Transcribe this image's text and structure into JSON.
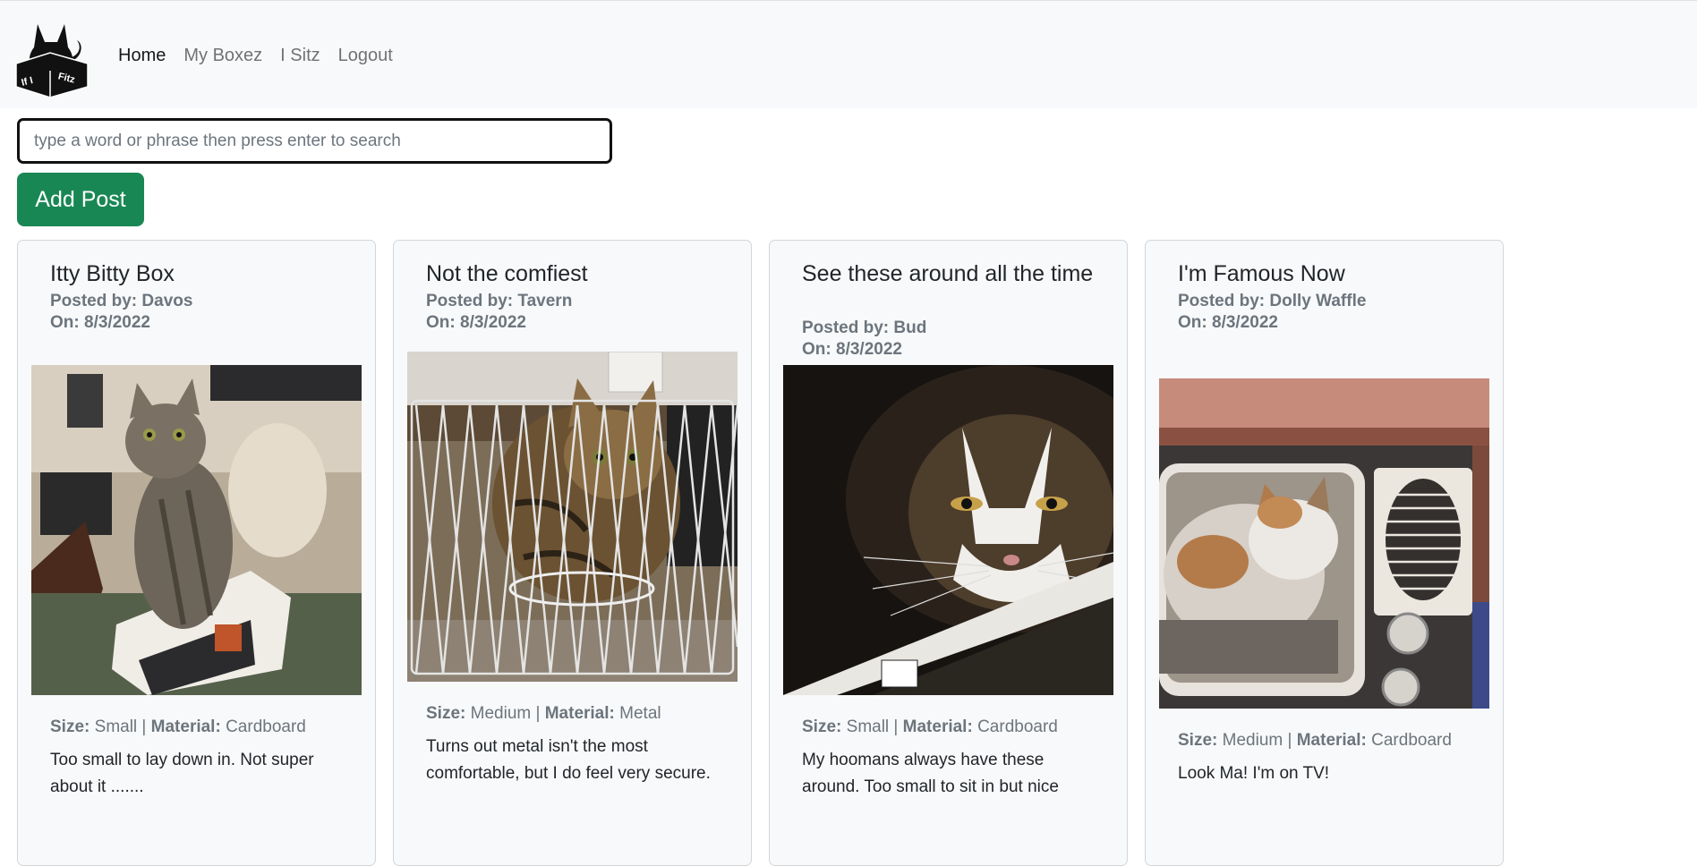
{
  "nav": {
    "logo_text_left": "If I",
    "logo_text_right": "Fitz",
    "links": [
      "Home",
      "My Boxez",
      "I Sitz",
      "Logout"
    ]
  },
  "search": {
    "placeholder": "type a word or phrase then press enter to search",
    "value": ""
  },
  "add_post_label": "Add Post",
  "labels": {
    "posted_by": "Posted by:",
    "on": "On:",
    "size": "Size:",
    "material": "Material:"
  },
  "posts": [
    {
      "title": "Itty Bitty Box",
      "author": "Davos",
      "date": "8/3/2022",
      "size": "Small",
      "material": "Cardboard",
      "description": "Too small to lay down in. Not super about it ......."
    },
    {
      "title": "Not the comfiest",
      "author": "Tavern",
      "date": "8/3/2022",
      "size": "Medium",
      "material": "Metal",
      "description": "Turns out metal isn't the most comfortable, but I do feel very secure."
    },
    {
      "title": "See these around all the time",
      "author": "Bud",
      "date": "8/3/2022",
      "size": "Small",
      "material": "Cardboard",
      "description": "My hoomans always have these around. Too small to sit in but nice"
    },
    {
      "title": "I'm Famous Now",
      "author": "Dolly Waffle",
      "date": "8/3/2022",
      "size": "Medium",
      "material": "Cardboard",
      "description": "Look Ma! I'm on TV!"
    }
  ],
  "colors": {
    "accent": "#198754",
    "navbar_bg": "#f8f9fa",
    "card_bg": "#f8f9fa",
    "muted": "#6c757d"
  }
}
